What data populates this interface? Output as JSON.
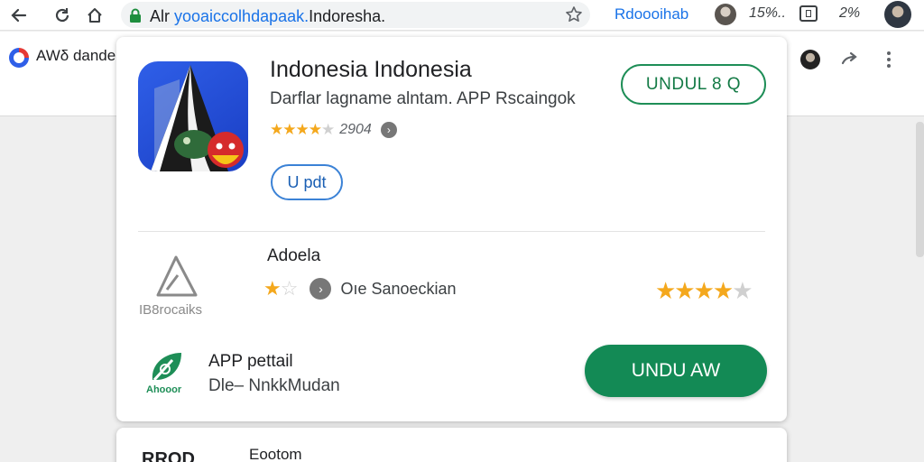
{
  "browser": {
    "url_prefix": "Alr",
    "url_host": "yooaiccolhdapaak.",
    "url_rest": "Indoresha.",
    "profile_link": "Rdoooihab",
    "counter": "15%..",
    "battery": "2%"
  },
  "bookmarks": {
    "site_name": "AWδ dande"
  },
  "app": {
    "title": "Indonesia Indonesia",
    "subtitle": "Darflar lagname alntam. APP Rscaingok",
    "rating_count": "2904",
    "update_label": "U pdt",
    "download_label": "UNDUL 8 Q"
  },
  "row2": {
    "title": "Adoela",
    "caption": "IB8rocaiks",
    "text": "Oıe Sanoeckian"
  },
  "row3": {
    "caption": "Ahooor",
    "title": "APP pettail",
    "subtitle": "Dle– NnkkMudan",
    "download_label": "UNDU AW"
  },
  "card2": {
    "left_text": "RROD",
    "title": "Eootom"
  },
  "colors": {
    "accent_blue": "#1a73e8",
    "brand_green": "#138a55",
    "star_gold": "#f4a81d"
  },
  "icons": {
    "back": "back-arrow-icon",
    "reload": "reload-icon",
    "home": "home-icon",
    "lock": "lock-icon",
    "bookmark_star": "star-outline-icon",
    "share": "share-icon",
    "menu": "more-vert-icon"
  }
}
